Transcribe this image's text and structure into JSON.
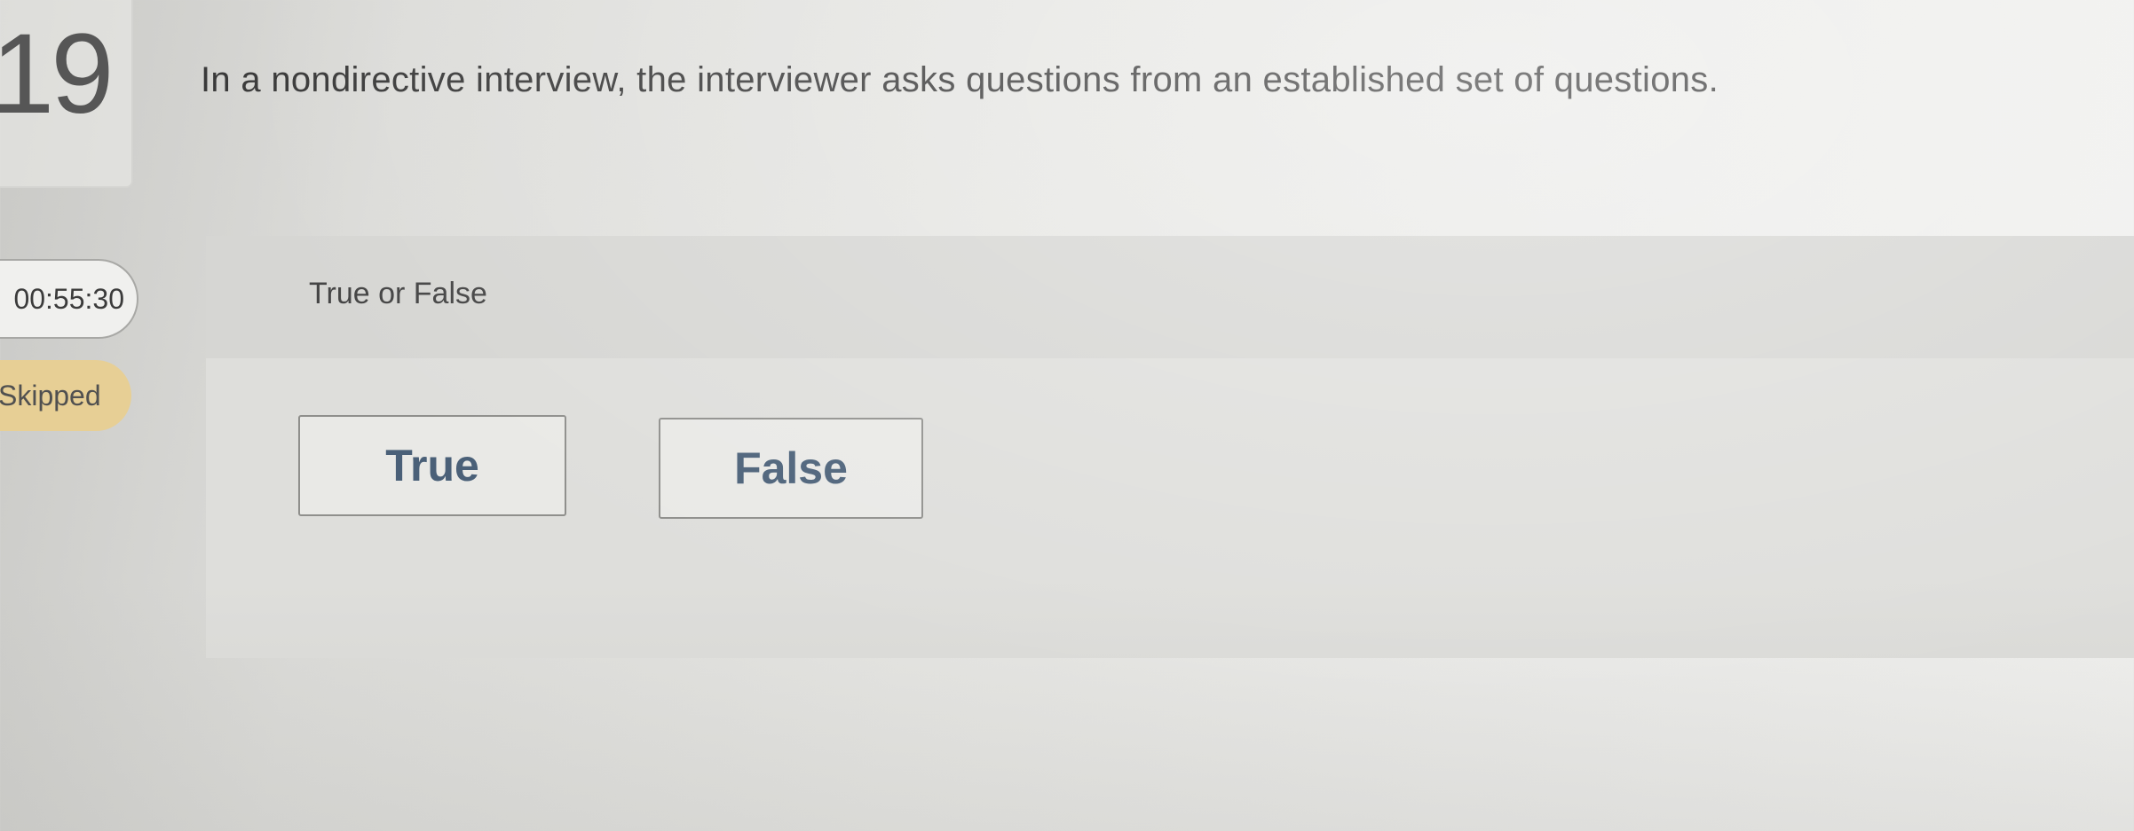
{
  "question": {
    "number": "19",
    "text": "In a nondirective interview, the interviewer asks questions from an established set of questions."
  },
  "status": {
    "timer": "00:55:30",
    "skipped_label": "Skipped"
  },
  "answer": {
    "type_label": "True or False",
    "choices": [
      {
        "label": "True"
      },
      {
        "label": "False"
      }
    ]
  },
  "colors": {
    "skipped_badge": "#e7cf95",
    "choice_text": "#4a6078"
  }
}
